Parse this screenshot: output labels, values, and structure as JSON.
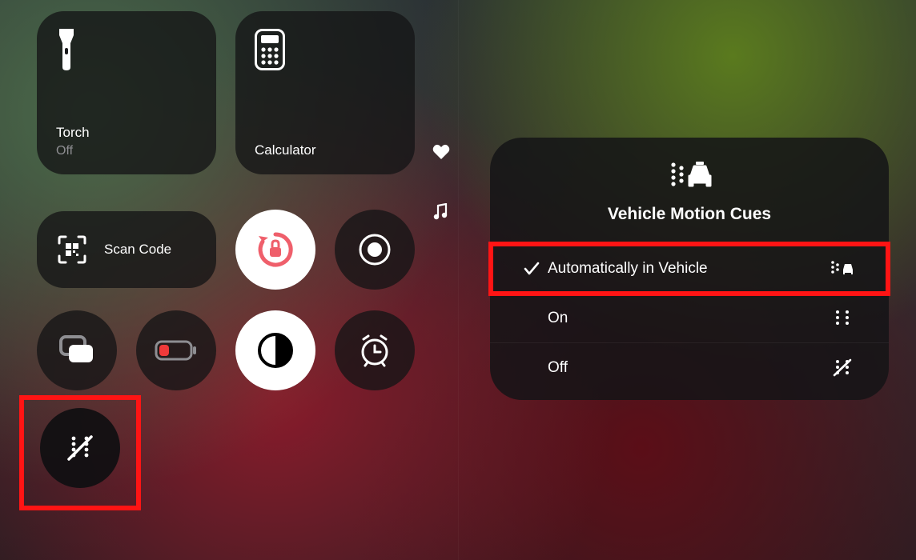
{
  "left": {
    "torch": {
      "title": "Torch",
      "status": "Off"
    },
    "calculator": {
      "title": "Calculator"
    },
    "scan": {
      "label": "Scan Code"
    }
  },
  "popup": {
    "title": "Vehicle Motion Cues",
    "options": {
      "auto": "Automatically in Vehicle",
      "on": "On",
      "off": "Off"
    }
  }
}
